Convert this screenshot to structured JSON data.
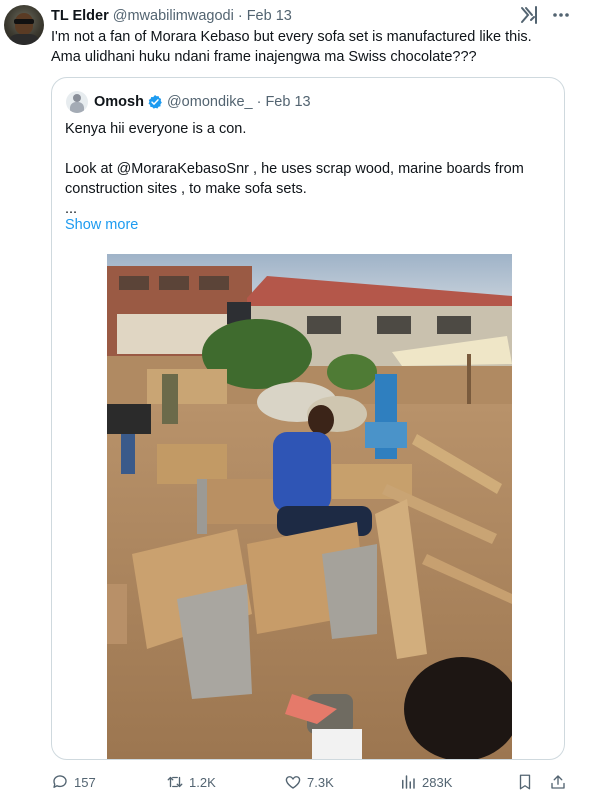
{
  "tweet": {
    "author_name": "TL Elder",
    "author_handle": "@mwabilimwagodi",
    "separator": "·",
    "date": "Feb 13",
    "text_lines": [
      "I'm not a fan of Morara Kebaso but every sofa set is manufactured like this.",
      "Ama ulidhani huku ndani frame inajengwa ma Swiss chocolate???"
    ],
    "grok_icon": "grok-icon",
    "more_icon": "more-options-icon"
  },
  "quote": {
    "author_name": "Omosh",
    "author_handle": "@omondike_",
    "separator": "·",
    "date": "Feb 13",
    "verified_color": "#1d9bf0",
    "text_lines": [
      "Kenya hii everyone is a con.",
      "",
      "Look at @MoraraKebasoSnr , he uses scrap wood, marine boards from",
      "construction sites , to make sofa sets.",
      "..."
    ],
    "show_more": "Show more"
  },
  "actions": {
    "replies": "157",
    "reposts": "1.2K",
    "likes": "7.3K",
    "views": "283K"
  },
  "colors": {
    "text_primary": "#0f1419",
    "text_secondary": "#536471",
    "link": "#1d9bf0",
    "border": "#cfd9de"
  }
}
